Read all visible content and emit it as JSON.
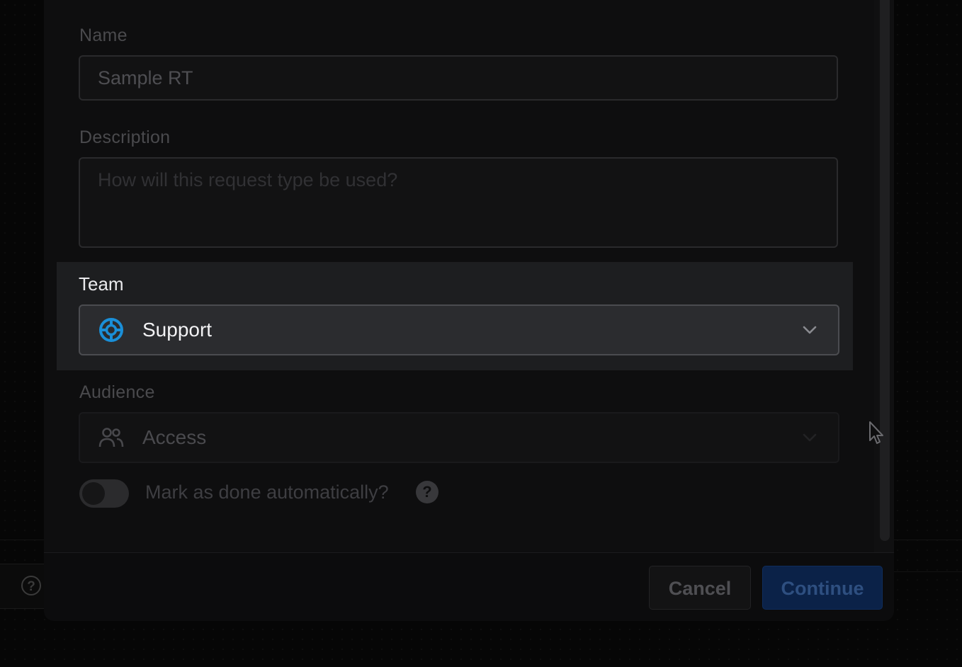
{
  "form": {
    "name": {
      "label": "Name",
      "value": "Sample RT"
    },
    "description": {
      "label": "Description",
      "placeholder": "How will this request type be used?"
    },
    "team": {
      "label": "Team",
      "value": "Support",
      "icon": "lifebuoy-icon"
    },
    "audience": {
      "label": "Audience",
      "value": "Access",
      "icon": "users-icon"
    },
    "auto_done": {
      "label": "Mark as done automatically?",
      "enabled": false
    }
  },
  "footer": {
    "cancel_label": "Cancel",
    "continue_label": "Continue"
  },
  "background": {
    "help_glyph": "?"
  },
  "colors": {
    "team_icon": "#1a8fd8",
    "continue_bg": "#0b2248"
  }
}
